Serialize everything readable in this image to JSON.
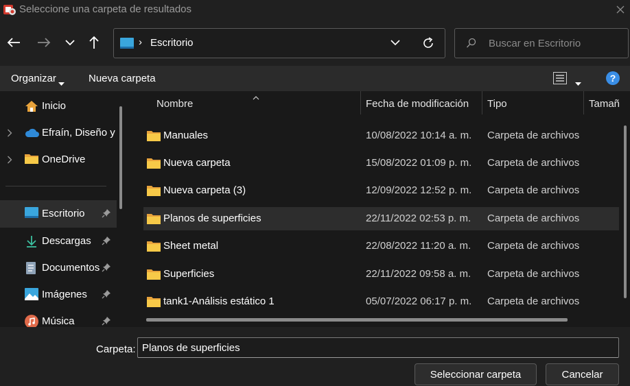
{
  "window": {
    "title": "Seleccione una carpeta de resultados"
  },
  "address": {
    "location": "Escritorio",
    "separator": "›"
  },
  "search": {
    "placeholder": "Buscar en Escritorio"
  },
  "command_bar": {
    "organize": "Organizar",
    "new_folder": "Nueva carpeta"
  },
  "sidebar": {
    "items": [
      {
        "label": "Inicio",
        "icon": "home-icon",
        "has_chevron": false,
        "pinned": false
      },
      {
        "label": "Efraín, Diseño y",
        "icon": "cloud-icon",
        "has_chevron": true,
        "pinned": false
      },
      {
        "label": "OneDrive",
        "icon": "folder-icon",
        "has_chevron": true,
        "pinned": false
      },
      {
        "label": "Escritorio",
        "icon": "desktop-icon",
        "has_chevron": false,
        "pinned": true,
        "active": true
      },
      {
        "label": "Descargas",
        "icon": "download-icon",
        "has_chevron": false,
        "pinned": true
      },
      {
        "label": "Documentos",
        "icon": "document-icon",
        "has_chevron": false,
        "pinned": true
      },
      {
        "label": "Imágenes",
        "icon": "image-icon",
        "has_chevron": false,
        "pinned": true
      },
      {
        "label": "Música",
        "icon": "music-icon",
        "has_chevron": false,
        "pinned": true
      }
    ]
  },
  "columns": {
    "name": "Nombre",
    "date": "Fecha de modificación",
    "type": "Tipo",
    "size": "Tamañ"
  },
  "files": [
    {
      "name": "Manuales",
      "date": "10/08/2022 10:14 a. m.",
      "type": "Carpeta de archivos"
    },
    {
      "name": "Nueva carpeta",
      "date": "15/08/2022 01:09 p. m.",
      "type": "Carpeta de archivos"
    },
    {
      "name": "Nueva carpeta (3)",
      "date": "12/09/2022 12:52 p. m.",
      "type": "Carpeta de archivos"
    },
    {
      "name": "Planos de superficies",
      "date": "22/11/2022 02:53 p. m.",
      "type": "Carpeta de archivos",
      "selected": true
    },
    {
      "name": "Sheet metal",
      "date": "22/08/2022 11:20 a. m.",
      "type": "Carpeta de archivos"
    },
    {
      "name": "Superficies",
      "date": "22/11/2022 09:58 a. m.",
      "type": "Carpeta de archivos"
    },
    {
      "name": "tank1-Análisis estático 1",
      "date": "05/07/2022 06:17 p. m.",
      "type": "Carpeta de archivos"
    }
  ],
  "footer": {
    "folder_label": "Carpeta:",
    "folder_value": "Planos de superficies",
    "select_button": "Seleccionar carpeta",
    "cancel_button": "Cancelar"
  },
  "colors": {
    "folder_yellow": "#f7c948",
    "help_blue": "#3a8ee6",
    "selected_row": "#2d2d2d"
  }
}
